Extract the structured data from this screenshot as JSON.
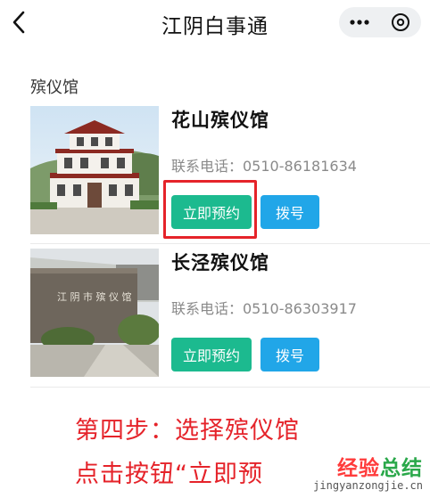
{
  "header": {
    "title": "江阴白事通",
    "back_icon": "chevron-left-icon",
    "more_icon": "more-dots-icon",
    "close_icon": "close-circle-icon"
  },
  "section": {
    "label": "殡仪馆"
  },
  "homes": [
    {
      "name": "花山殡仪馆",
      "phone": "联系电话：0510-86181634",
      "book_label": "立即预约",
      "dial_label": "拨号"
    },
    {
      "name": "长泾殡仪馆",
      "phone": "联系电话：0510-86303917",
      "book_label": "立即预约",
      "dial_label": "拨号"
    }
  ],
  "annotation": {
    "line1": "第四步：选择殡仪馆",
    "line2": "点击按钮“立即预"
  },
  "watermark": {
    "text_a": "经验",
    "text_b": "总结",
    "url": "jingyanzongjie.cn"
  },
  "colors": {
    "book_button": "#1cba8f",
    "dial_button": "#21a6e8",
    "annotation": "#e5232a"
  }
}
